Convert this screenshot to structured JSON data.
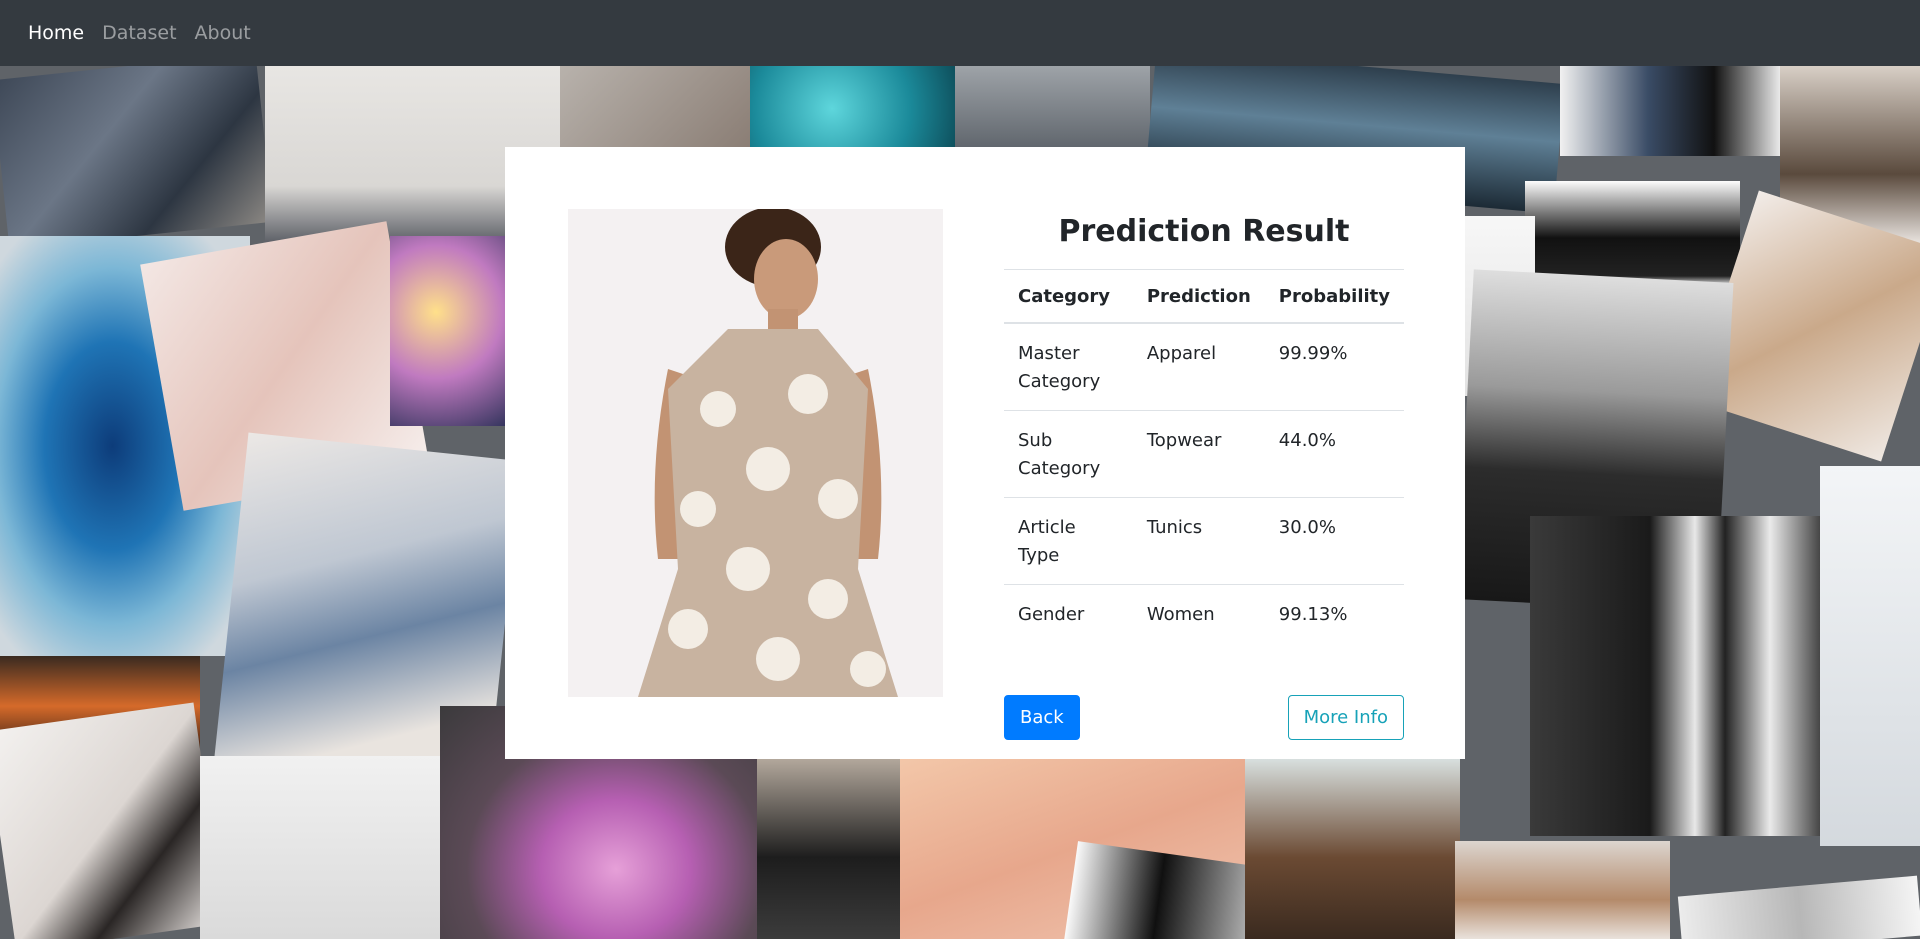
{
  "nav": {
    "home": "Home",
    "dataset": "Dataset",
    "about": "About"
  },
  "result": {
    "title": "Prediction Result",
    "columns": [
      "Category",
      "Prediction",
      "Probability"
    ],
    "rows": [
      {
        "category": "Master Category",
        "prediction": "Apparel",
        "probability": "99.99%"
      },
      {
        "category": "Sub Category",
        "prediction": "Topwear",
        "probability": "44.0%"
      },
      {
        "category": "Article Type",
        "prediction": "Tunics",
        "probability": "30.0%"
      },
      {
        "category": "Gender",
        "prediction": "Women",
        "probability": "99.13%"
      }
    ]
  },
  "buttons": {
    "back": "Back",
    "more_info": "More Info"
  },
  "colors": {
    "navbar": "#343a40",
    "primary": "#007bff",
    "info": "#17a2b8"
  }
}
